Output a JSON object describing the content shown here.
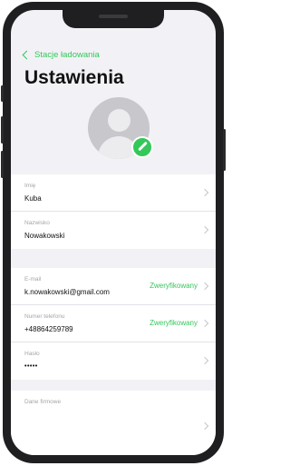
{
  "nav": {
    "back_label": "Stacje ładowania"
  },
  "page": {
    "title": "Ustawienia"
  },
  "profile": {
    "avatar_icon": "user-avatar-icon",
    "edit_icon": "pencil-icon",
    "accent_color": "#34c759"
  },
  "personal": {
    "first_name_label": "Imię",
    "first_name_value": "Kuba",
    "last_name_label": "Nazwisko",
    "last_name_value": "Nowakowski"
  },
  "account": {
    "email_label": "E-mail",
    "email_value": "k.nowakowski@gmail.com",
    "email_status": "Zweryfikowany",
    "phone_label": "Numer telefonu",
    "phone_value": "+48864259789",
    "phone_status": "Zweryfikowany",
    "password_label": "Hasło",
    "password_value": "•••••"
  },
  "company": {
    "label": "Dane firmowe"
  }
}
